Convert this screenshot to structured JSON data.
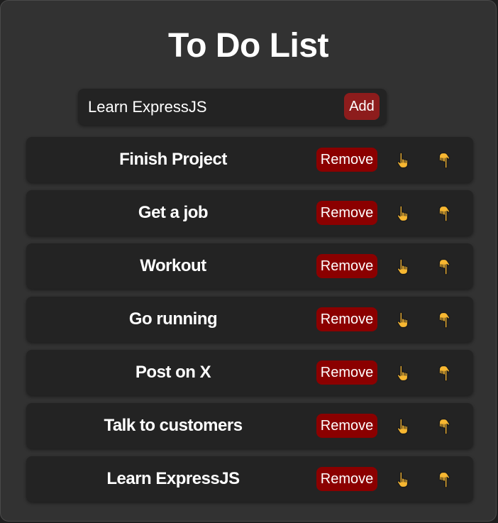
{
  "app": {
    "title": "To Do List"
  },
  "input": {
    "value": "Learn ExpressJS",
    "add_label": "Add"
  },
  "tasks": [
    {
      "text": "Finish Project"
    },
    {
      "text": "Get a job"
    },
    {
      "text": "Workout"
    },
    {
      "text": "Go running"
    },
    {
      "text": "Post on X"
    },
    {
      "text": "Talk to customers"
    },
    {
      "text": "Learn ExpressJS"
    }
  ],
  "task_actions": {
    "remove_label": "Remove",
    "move_up_icon": "pointing-up-hand-icon",
    "move_down_icon": "pointing-down-hand-icon"
  },
  "colors": {
    "accent_red": "#8b0000",
    "add_red": "#8d1c1c",
    "hand_yellow": "#f7b731"
  }
}
